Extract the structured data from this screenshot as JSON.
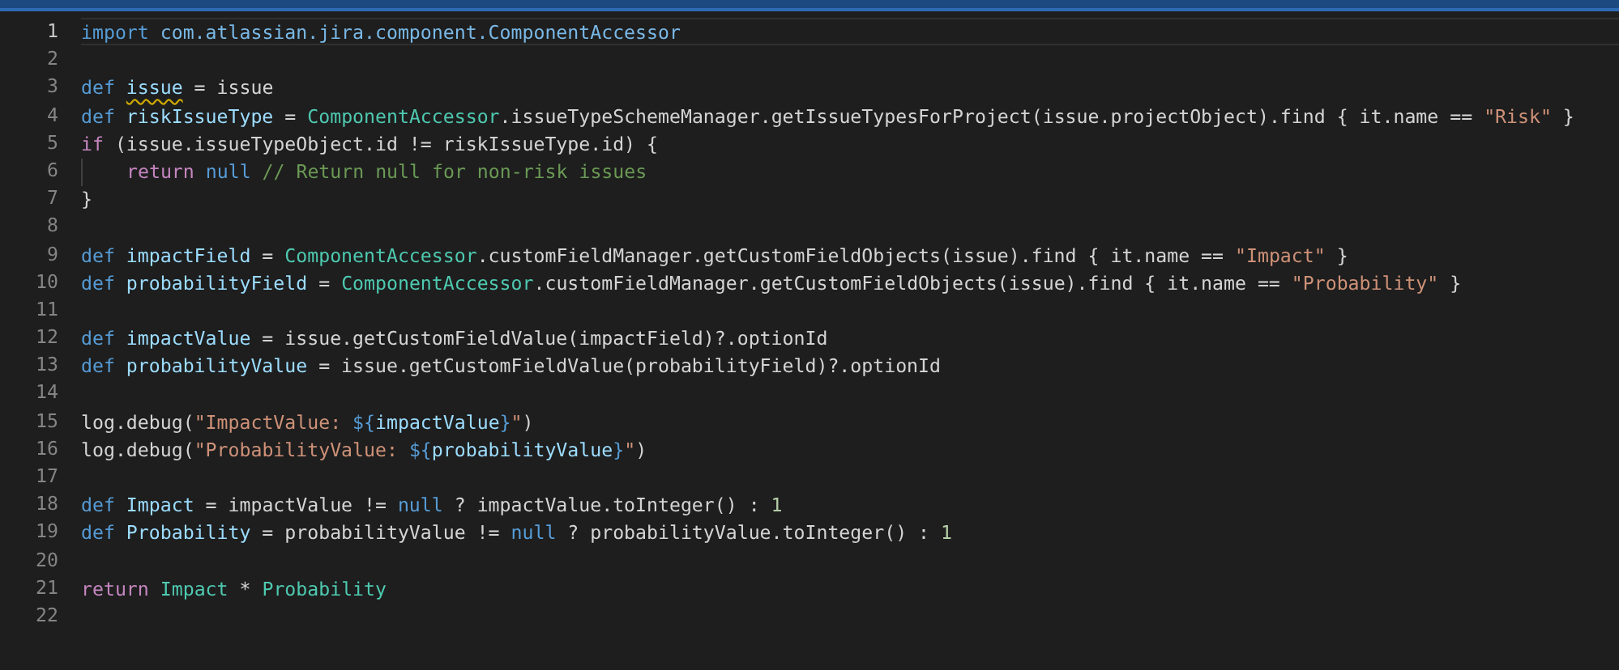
{
  "editor": {
    "lines": [
      {
        "number": "1",
        "current": true,
        "tokens": [
          {
            "kind": "keyword",
            "text": "import"
          },
          {
            "kind": "package",
            "text": " com.atlassian.jira.component.ComponentAccessor"
          }
        ]
      },
      {
        "number": "2",
        "current": false
      },
      {
        "number": "3",
        "current": false,
        "tokens": [
          {
            "kind": "keyword",
            "text": "def "
          },
          {
            "kind": "variable",
            "text": "issue",
            "warning": true
          },
          {
            "kind": "plain",
            "text": " = issue"
          }
        ]
      },
      {
        "number": "4",
        "current": false,
        "tokens": [
          {
            "kind": "keyword",
            "text": "def "
          },
          {
            "kind": "variable",
            "text": "riskIssueType"
          },
          {
            "kind": "plain",
            "text": " = "
          },
          {
            "kind": "class",
            "text": "ComponentAccessor"
          },
          {
            "kind": "plain",
            "text": ".issueTypeSchemeManager.getIssueTypesForProject(issue.projectObject).find { it.name == "
          },
          {
            "kind": "string",
            "text": "\"Risk\""
          },
          {
            "kind": "plain",
            "text": " }"
          }
        ]
      },
      {
        "number": "5",
        "current": false,
        "tokens": [
          {
            "kind": "control",
            "text": "if"
          },
          {
            "kind": "plain",
            "text": " (issue.issueTypeObject.id != riskIssueType.id) {"
          }
        ]
      },
      {
        "number": "6",
        "current": false,
        "indented": true,
        "tokens": [
          {
            "kind": "control",
            "text": "return "
          },
          {
            "kind": "keyword",
            "text": "null "
          },
          {
            "kind": "comment",
            "text": "// Return null for non-risk issues"
          }
        ]
      },
      {
        "number": "7",
        "current": false,
        "tokens": [
          {
            "kind": "plain",
            "text": "}"
          }
        ]
      },
      {
        "number": "8",
        "current": false
      },
      {
        "number": "9",
        "current": false,
        "tokens": [
          {
            "kind": "keyword",
            "text": "def "
          },
          {
            "kind": "variable",
            "text": "impactField"
          },
          {
            "kind": "plain",
            "text": " = "
          },
          {
            "kind": "class",
            "text": "ComponentAccessor"
          },
          {
            "kind": "plain",
            "text": ".customFieldManager.getCustomFieldObjects(issue).find { it.name == "
          },
          {
            "kind": "string",
            "text": "\"Impact\""
          },
          {
            "kind": "plain",
            "text": " }"
          }
        ]
      },
      {
        "number": "10",
        "current": false,
        "tokens": [
          {
            "kind": "keyword",
            "text": "def "
          },
          {
            "kind": "variable",
            "text": "probabilityField"
          },
          {
            "kind": "plain",
            "text": " = "
          },
          {
            "kind": "class",
            "text": "ComponentAccessor"
          },
          {
            "kind": "plain",
            "text": ".customFieldManager.getCustomFieldObjects(issue).find { it.name == "
          },
          {
            "kind": "string",
            "text": "\"Probability\""
          },
          {
            "kind": "plain",
            "text": " }"
          }
        ]
      },
      {
        "number": "11",
        "current": false
      },
      {
        "number": "12",
        "current": false,
        "tokens": [
          {
            "kind": "keyword",
            "text": "def "
          },
          {
            "kind": "variable",
            "text": "impactValue"
          },
          {
            "kind": "plain",
            "text": " = issue.getCustomFieldValue(impactField)?.optionId"
          }
        ]
      },
      {
        "number": "13",
        "current": false,
        "tokens": [
          {
            "kind": "keyword",
            "text": "def "
          },
          {
            "kind": "variable",
            "text": "probabilityValue"
          },
          {
            "kind": "plain",
            "text": " = issue.getCustomFieldValue(probabilityField)?.optionId"
          }
        ]
      },
      {
        "number": "14",
        "current": false
      },
      {
        "number": "15",
        "current": false,
        "tokens": [
          {
            "kind": "plain",
            "text": "log.debug("
          },
          {
            "kind": "string",
            "text": "\"ImpactValue: "
          },
          {
            "kind": "keyword",
            "text": "${"
          },
          {
            "kind": "variable",
            "text": "impactValue"
          },
          {
            "kind": "keyword",
            "text": "}"
          },
          {
            "kind": "string",
            "text": "\""
          },
          {
            "kind": "plain",
            "text": ")"
          }
        ]
      },
      {
        "number": "16",
        "current": false,
        "tokens": [
          {
            "kind": "plain",
            "text": "log.debug("
          },
          {
            "kind": "string",
            "text": "\"ProbabilityValue: "
          },
          {
            "kind": "keyword",
            "text": "${"
          },
          {
            "kind": "variable",
            "text": "probabilityValue"
          },
          {
            "kind": "keyword",
            "text": "}"
          },
          {
            "kind": "string",
            "text": "\""
          },
          {
            "kind": "plain",
            "text": ")"
          }
        ]
      },
      {
        "number": "17",
        "current": false
      },
      {
        "number": "18",
        "current": false,
        "tokens": [
          {
            "kind": "keyword",
            "text": "def "
          },
          {
            "kind": "variable",
            "text": "Impact"
          },
          {
            "kind": "plain",
            "text": " = impactValue != "
          },
          {
            "kind": "keyword",
            "text": "null"
          },
          {
            "kind": "plain",
            "text": " ? impactValue.toInteger() : "
          },
          {
            "kind": "number",
            "text": "1"
          }
        ]
      },
      {
        "number": "19",
        "current": false,
        "tokens": [
          {
            "kind": "keyword",
            "text": "def "
          },
          {
            "kind": "variable",
            "text": "Probability"
          },
          {
            "kind": "plain",
            "text": " = probabilityValue != "
          },
          {
            "kind": "keyword",
            "text": "null"
          },
          {
            "kind": "plain",
            "text": " ? probabilityValue.toInteger() : "
          },
          {
            "kind": "number",
            "text": "1"
          }
        ]
      },
      {
        "number": "20",
        "current": false
      },
      {
        "number": "21",
        "current": false,
        "tokens": [
          {
            "kind": "control",
            "text": "return "
          },
          {
            "kind": "class",
            "text": "Impact"
          },
          {
            "kind": "plain",
            "text": " * "
          },
          {
            "kind": "class",
            "text": "Probability"
          }
        ]
      },
      {
        "number": "22",
        "current": false
      }
    ]
  }
}
